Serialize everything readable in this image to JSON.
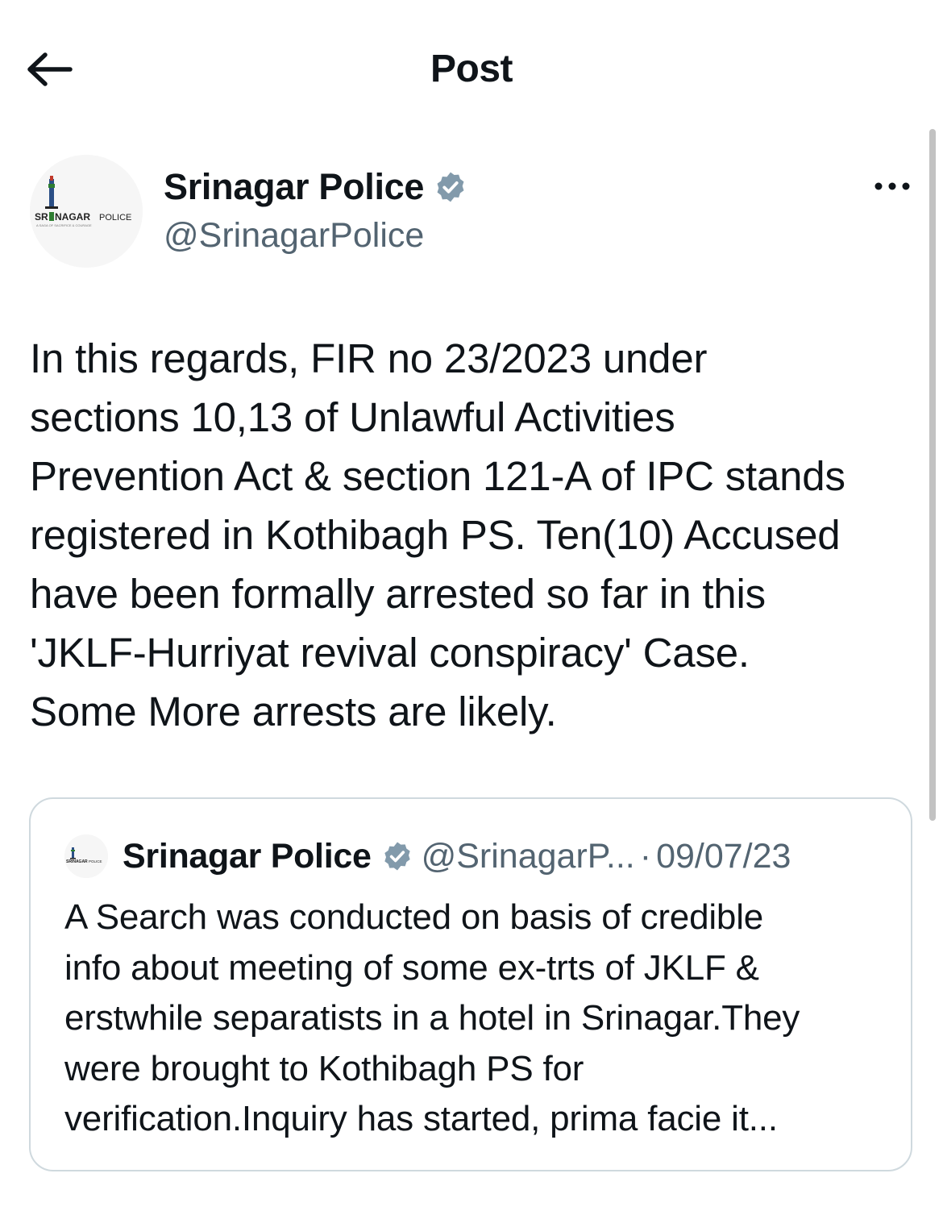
{
  "header": {
    "title": "Post",
    "back_icon": "arrow-left-icon"
  },
  "post": {
    "author": {
      "name": "Srinagar Police",
      "handle": "@SrinagarPolice",
      "verified": true,
      "verified_icon": "verified-badge-icon",
      "avatar_logo_text": "SRINAGAR POLICE",
      "avatar_tagline": "A SAGA OF SACRIFICE & COURAGE"
    },
    "more_icon": "more-options-icon",
    "text": "In this regards, FIR no 23/2023 under\nsections 10,13 of Unlawful Activities\nPrevention Act & section 121-A of IPC stands\nregistered in Kothibagh PS. Ten(10) Accused\nhave been formally arrested so far in this\n'JKLF-Hurriyat revival conspiracy' Case.\nSome More arrests are likely."
  },
  "quoted_post": {
    "author_name": "Srinagar Police",
    "handle": "@SrinagarP...",
    "separator": "·",
    "date": "09/07/23",
    "text": "A Search was conducted on basis of credible\ninfo about meeting of some ex-trts of JKLF &\nerstwhile separatists in a hotel in Srinagar.They\nwere brought to Kothibagh PS for\nverification.Inquiry has started, prima facie it..."
  },
  "colors": {
    "text_primary": "#0f1419",
    "text_secondary": "#536471",
    "border": "#cfd9de",
    "verified_badge": "#829aab",
    "scrollbar": "#c2c2c2"
  }
}
